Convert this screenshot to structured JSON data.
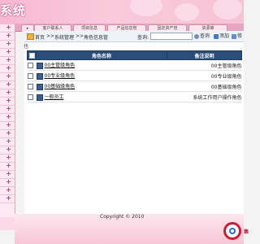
{
  "header": {
    "title": "系统"
  },
  "tabs": [
    {
      "label": "▸"
    },
    {
      "label": "客户联系人"
    },
    {
      "label": "项目信息"
    },
    {
      "label": "产品信息管"
    },
    {
      "label": "固定资产管"
    },
    {
      "label": "资源审"
    }
  ],
  "toolbar": {
    "home": "首页",
    "sep1": ">>",
    "section": "系统管理",
    "sep2": ">>",
    "page": "角色信息管",
    "search_label": "查询:",
    "search_value": "",
    "query_button": "查询",
    "add_button": "添加",
    "edit_button": "修"
  },
  "stub_text": "也",
  "table": {
    "columns": [
      "",
      "角色名称",
      "备注说明"
    ],
    "rows": [
      {
        "name": "00主管级角色",
        "desc": "00主管级角色"
      },
      {
        "name": "00专业级角色",
        "desc": "00专业级角色"
      },
      {
        "name": "00基础级角色",
        "desc": "00基础级角色"
      },
      {
        "name": "一般员工",
        "desc": "系统工作用户操作角色"
      }
    ]
  },
  "footer": {
    "copyright": "Copyright © 2010",
    "logo_text": "集"
  },
  "colors": {
    "header_pink": "#f7b8d0",
    "table_header": "#2a4d7a",
    "logo_red": "#c91d3a"
  }
}
